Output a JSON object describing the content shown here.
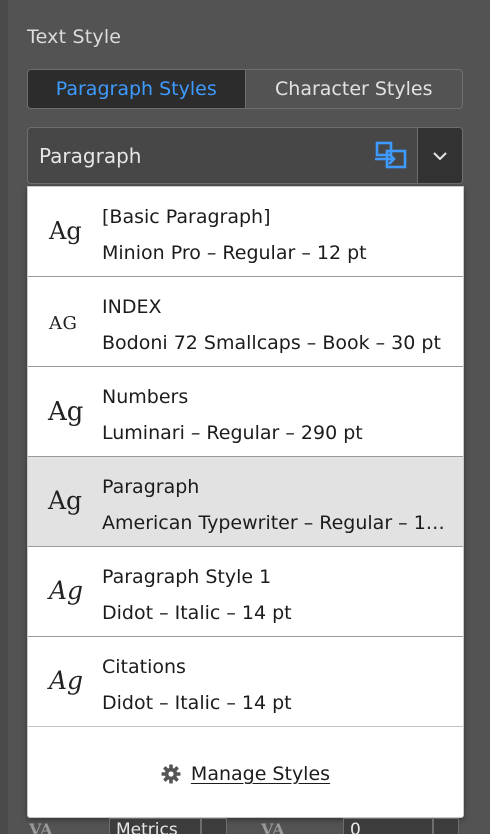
{
  "panel": {
    "section_title": "Text Style",
    "tabs": [
      {
        "label": "Paragraph Styles",
        "active": true
      },
      {
        "label": "Character Styles",
        "active": false
      }
    ],
    "current_style": "Paragraph",
    "accent_color": "#3d9bff"
  },
  "styles_list": {
    "items": [
      {
        "glyph": "Ag",
        "name": "[Basic Paragraph]",
        "detail": "Minion Pro – Regular – 12 pt",
        "selected": false
      },
      {
        "glyph": "AG",
        "name": "INDEX",
        "detail": "Bodoni 72 Smallcaps – Book – 30 pt",
        "selected": false
      },
      {
        "glyph": "Ag",
        "name": "Numbers",
        "detail": "Luminari – Regular – 290 pt",
        "selected": false
      },
      {
        "glyph": "Ag",
        "name": "Paragraph",
        "detail": "American Typewriter – Regular – 1…",
        "selected": true
      },
      {
        "glyph": "Ag",
        "name": "Paragraph Style 1",
        "detail": "Didot – Italic – 14 pt",
        "selected": false
      },
      {
        "glyph": "Ag",
        "name": "Citations",
        "detail": "Didot – Italic – 14 pt",
        "selected": false
      }
    ],
    "manage_label": "Manage Styles"
  },
  "character_row": {
    "kerning_icon": "VA",
    "kerning_value": "Metrics",
    "tracking_icon": "VA",
    "tracking_value": "0"
  }
}
